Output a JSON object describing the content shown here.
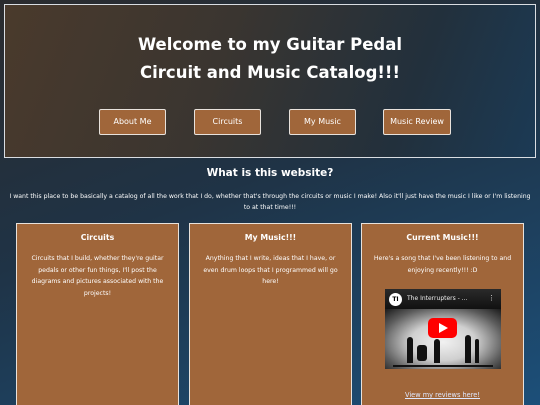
{
  "hero": {
    "title_line1": "Welcome to my Guitar Pedal",
    "title_line2": "Circuit and Music Catalog!!!"
  },
  "nav": {
    "about": "About Me",
    "circuits": "Circuits",
    "music": "My Music",
    "review": "Music Review"
  },
  "intro": {
    "heading": "What is this website?",
    "text": "I want this place to be basically a catalog of all the work that I do, whether that's through the circuits or music I make! Also it'll just have the music I like or I'm listening to at that time!!!"
  },
  "cards": [
    {
      "title": "Circuits",
      "text": "Circuits that I build, whether they're guitar pedals or other fun things, I'll post the diagrams and pictures associated with the projects!"
    },
    {
      "title": "My Music!!!",
      "text": "Anything that I write, ideas that I have, or even drum loops that I programmed will go here!"
    },
    {
      "title": "Current Music!!!",
      "text": "Here's a song that I've been listening to and enjoying recently!!! :D",
      "video_title": "The Interrupters - ...",
      "link": "View my reviews here!"
    }
  ],
  "colors": {
    "card_bg": "#a0663a",
    "border": "#e8e2dc",
    "play_button": "#ff0000"
  },
  "icons": {
    "channel": "channel-avatar-icon",
    "play": "play-icon",
    "menu": "more-vert-icon"
  }
}
